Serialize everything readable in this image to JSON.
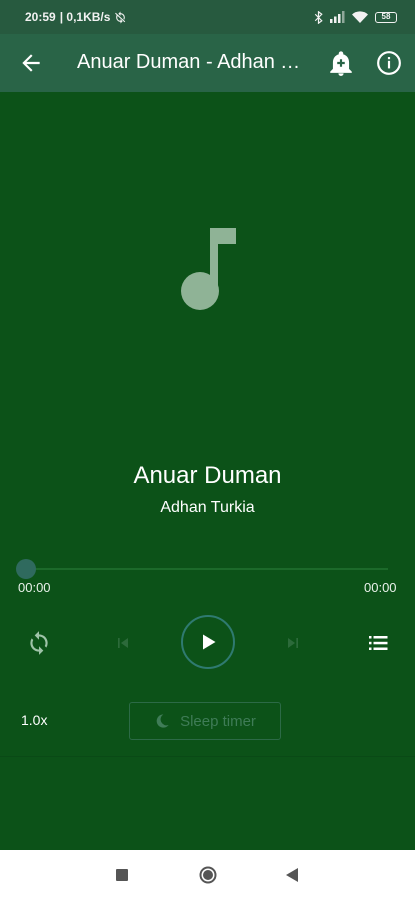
{
  "status_bar": {
    "time": "20:59",
    "network_speed": "| 0,1KB/s",
    "battery": "58"
  },
  "app_bar": {
    "title": "Anuar Duman - Adhan Turkia"
  },
  "track": {
    "title": "Anuar Duman",
    "artist": "Adhan Turkia"
  },
  "playback": {
    "elapsed": "00:00",
    "duration": "00:00",
    "progress": 0,
    "speed": "1.0x",
    "sleep_timer_label": "Sleep timer"
  },
  "colors": {
    "background": "#0c5218",
    "app_bar": "#296447",
    "status_bar": "#275a3f",
    "accent": "#2f7a70"
  }
}
